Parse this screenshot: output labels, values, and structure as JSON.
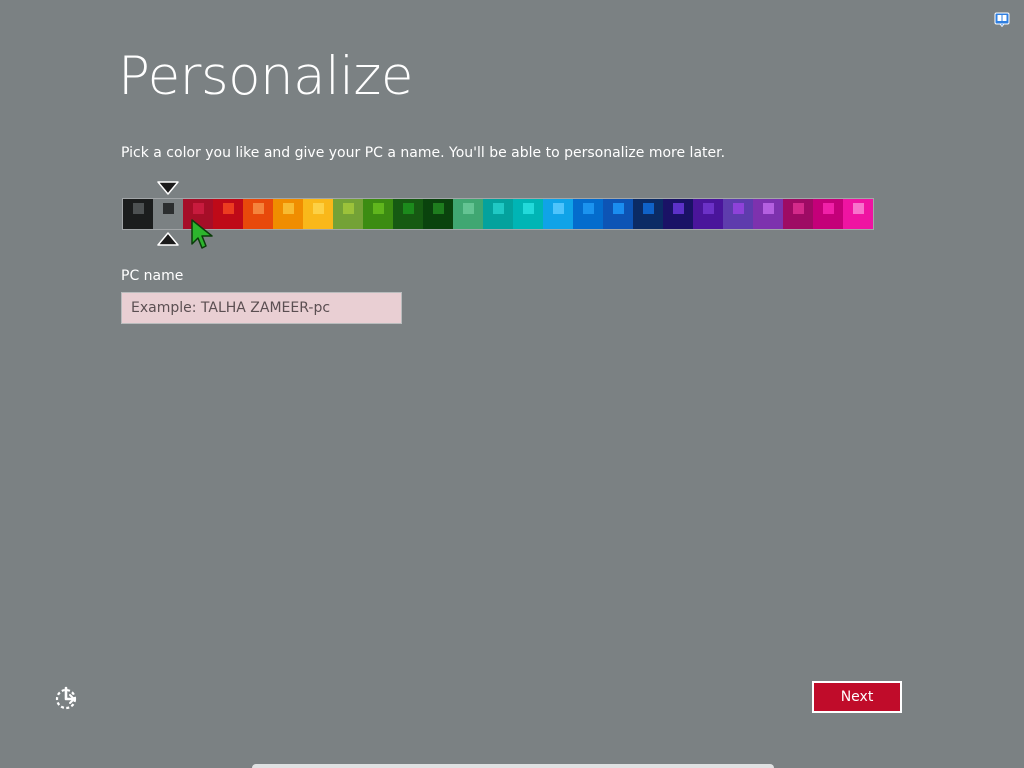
{
  "header": {
    "title": "Personalize",
    "subtitle": "Pick a color you like and give your PC a name. You'll be able to personalize more later.",
    "help_icon": "ease-of-access-help-icon"
  },
  "palette": {
    "selected_index": 1,
    "swatches": [
      {
        "base": "#1b1d1d",
        "chip": "#4d5152"
      },
      {
        "base": "#7b8183",
        "chip": "#2b2e2f"
      },
      {
        "base": "#a60e28",
        "chip": "#c81b3e"
      },
      {
        "base": "#bf0a18",
        "chip": "#ec3c20"
      },
      {
        "base": "#e8490b",
        "chip": "#f5833c"
      },
      {
        "base": "#f08d00",
        "chip": "#f8ba30"
      },
      {
        "base": "#f9b81a",
        "chip": "#fdd145"
      },
      {
        "base": "#74a236",
        "chip": "#9cc23a"
      },
      {
        "base": "#3c8c12",
        "chip": "#60b61d"
      },
      {
        "base": "#165a12",
        "chip": "#1c8a1c"
      },
      {
        "base": "#0a430d",
        "chip": "#1e7d1e"
      },
      {
        "base": "#40a772",
        "chip": "#64c493"
      },
      {
        "base": "#04a29d",
        "chip": "#20c9c4"
      },
      {
        "base": "#00b5b5",
        "chip": "#22dada"
      },
      {
        "base": "#10a3e8",
        "chip": "#4ec4fc"
      },
      {
        "base": "#046ccd",
        "chip": "#1b93ef"
      },
      {
        "base": "#0d54b5",
        "chip": "#1a8df0"
      },
      {
        "base": "#0b2b65",
        "chip": "#0f62c8"
      },
      {
        "base": "#1a1266",
        "chip": "#5c31c8"
      },
      {
        "base": "#4a159b",
        "chip": "#6c31c7"
      },
      {
        "base": "#5e3cad",
        "chip": "#8e42d9"
      },
      {
        "base": "#7d32ae",
        "chip": "#b460e0"
      },
      {
        "base": "#9e0b64",
        "chip": "#d42a8a"
      },
      {
        "base": "#c40079",
        "chip": "#f120a8"
      },
      {
        "base": "#ef14a2",
        "chip": "#f873cc"
      }
    ]
  },
  "pc_name": {
    "label": "PC name",
    "value": "",
    "placeholder": "Example: TALHA ZAMEER-pc"
  },
  "footer": {
    "ease_of_access_icon": "ease-of-access-icon",
    "next_label": "Next"
  },
  "colors": {
    "background": "#7b8183",
    "accent": "#c00c2a",
    "input_background": "#e9cfd3"
  }
}
